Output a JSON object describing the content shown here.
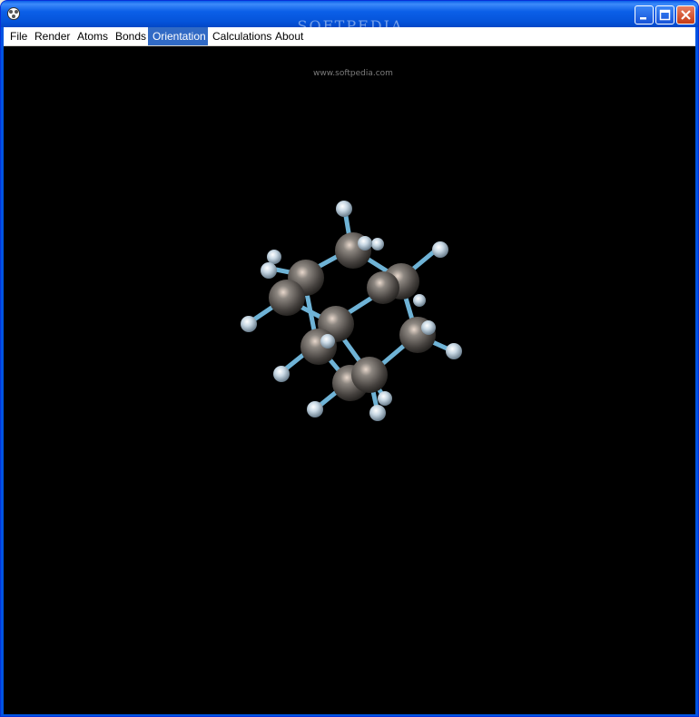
{
  "window": {
    "title": "",
    "watermark": "SOFTPEDIA",
    "watermark_url": "www.softpedia.com"
  },
  "titlebar_buttons": [
    {
      "name": "minimize-button"
    },
    {
      "name": "maximize-button"
    },
    {
      "name": "close-button"
    }
  ],
  "menu": {
    "items": [
      "File",
      "Render",
      "Atoms",
      "Bonds",
      "Orientation",
      "Calculations",
      "About"
    ],
    "active": "Orientation"
  },
  "viewport": {
    "background": "#000000",
    "molecule": {
      "carbon_count": 10,
      "hydrogen_count": 16,
      "carbon_color": "#6E6A66",
      "hydrogen_color": "#D8E8F2",
      "bond_color": "#6FB3D6"
    }
  }
}
